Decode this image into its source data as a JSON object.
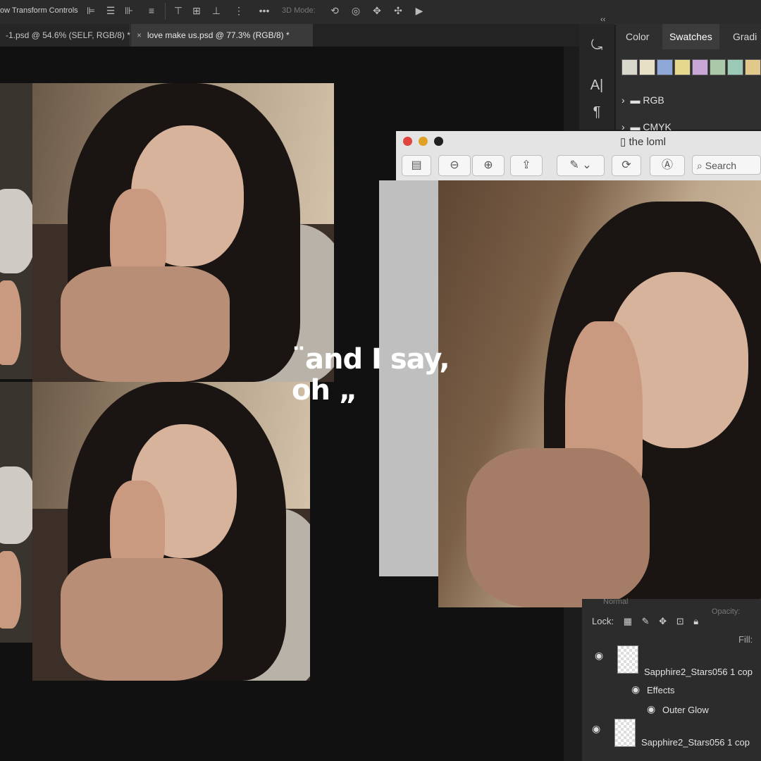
{
  "options_bar": {
    "show_transform_label": "ow Transform Controls",
    "mode_3d_label": "3D Mode:"
  },
  "tabs": [
    {
      "label": "-1.psd @ 54.6% (SELF, RGB/8) *",
      "active": false
    },
    {
      "label": "love make us.psd @ 77.3% (RGB/8) *",
      "active": true,
      "close": "×"
    }
  ],
  "right_panel": {
    "tabs": [
      "Color",
      "Swatches",
      "Gradi"
    ],
    "active_tab": "Swatches",
    "swatches": [
      "#d9d6cc",
      "#e8dfc7",
      "#8fa7d6",
      "#e6d98e",
      "#c9a6d6",
      "#a9c9a8",
      "#9bc9b5",
      "#e0c98a"
    ],
    "folders": [
      "RGB",
      "CMYK"
    ]
  },
  "caption": {
    "line1": "¨and I say,",
    "line2": "oh „"
  },
  "preview_window": {
    "title": "the loml",
    "search_label": "Search"
  },
  "layers_panel": {
    "normal_label": "Normal",
    "opacity_label": "Opacity:",
    "lock_label": "Lock:",
    "fill_label": "Fill:",
    "layers": [
      {
        "name": "Sapphire2_Stars056 1 cop",
        "effects_label": "Effects",
        "effect": "Outer Glow"
      },
      {
        "name": "Sapphire2_Stars056 1 cop"
      }
    ]
  }
}
